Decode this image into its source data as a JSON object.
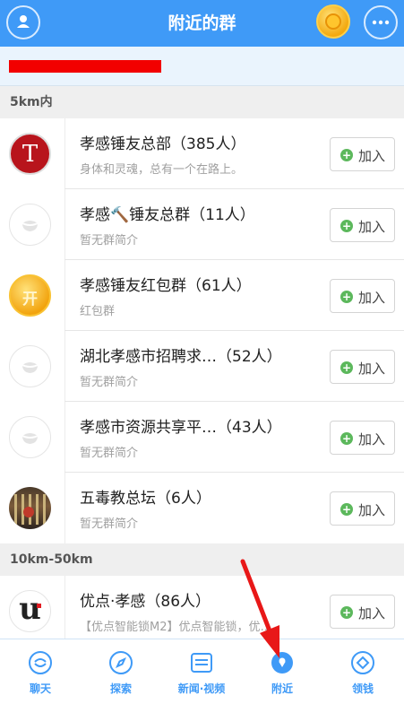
{
  "header": {
    "title": "附近的群"
  },
  "sections": [
    {
      "label": "5km内",
      "groups": [
        {
          "name": "孝感锤友总部（385人）",
          "desc": "身体和灵魂，总有一个在路上。",
          "join": "加入",
          "avatar_text": "T"
        },
        {
          "name": "孝感🔨锤友总群（11人）",
          "desc": "暂无群简介",
          "join": "加入"
        },
        {
          "name": "孝感锤友红包群（61人）",
          "desc": "红包群",
          "join": "加入",
          "avatar_text": "开"
        },
        {
          "name": "湖北孝感市招聘求…（52人）",
          "desc": "暂无群简介",
          "join": "加入"
        },
        {
          "name": "孝感市资源共享平…（43人）",
          "desc": "暂无群简介",
          "join": "加入"
        },
        {
          "name": "五毒教总坛（6人）",
          "desc": "暂无群简介",
          "join": "加入"
        }
      ]
    },
    {
      "label": "10km-50km",
      "groups": [
        {
          "name": "优点·孝感（86人）",
          "desc": "【优点智能锁M2】优点智能锁，优…",
          "join": "加入",
          "avatar_text": "u"
        }
      ]
    }
  ],
  "tabs": [
    {
      "label": "聊天",
      "icon": "chat-icon"
    },
    {
      "label": "探索",
      "icon": "compass-icon"
    },
    {
      "label": "新闻·视频",
      "icon": "news-icon"
    },
    {
      "label": "附近",
      "icon": "location-pin-icon"
    },
    {
      "label": "领钱",
      "icon": "diamond-icon"
    }
  ],
  "colors": {
    "accent": "#3f9af7",
    "join_plus": "#5cb85c",
    "annotation_arrow": "#e81818",
    "redaction": "#f20000"
  }
}
